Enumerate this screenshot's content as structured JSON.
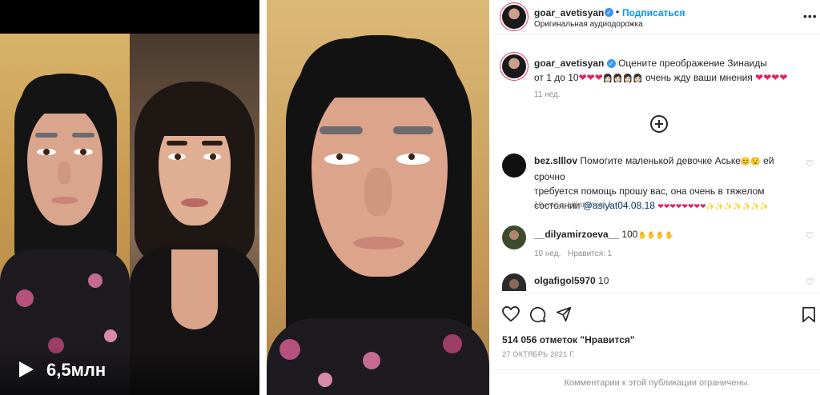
{
  "reel": {
    "views": "6,5млн",
    "play_icon": "play-icon"
  },
  "post": {
    "author": "goar_avetisyan",
    "follow_label": "Подписаться",
    "separator": "•",
    "audio": "Оригинальная аудиодорожка",
    "verified_icon": "verified-badge-icon",
    "more_icon": "more-options-icon"
  },
  "caption": {
    "username": "goar_avetisyan",
    "text_1": "Оцените преображение Зинаиды",
    "text_2": "от 1 до 10",
    "emoji_hearts_1": "❤❤❤",
    "emoji_faces": "👩🏻👩🏻👩🏻👩🏻",
    "text_3": "очень жду ваши мнения",
    "emoji_hearts_2": "❤❤❤❤",
    "time": "11 нед."
  },
  "load_more_icon": "add-circle-icon",
  "comments": [
    {
      "username": "bez.slllov",
      "text_1": "Помогите маленькой девочке Аське",
      "emoji_1": "😊😟",
      "text_2": "ей срочно",
      "line_2": "требуется помощь прошу вас, она очень в тяжелом",
      "line_3_text": "состоянии",
      "mention": "@asiyat04.08.18",
      "emoji_hearts": "❤❤❤❤❤❤❤❤",
      "emoji_stars": "✨✨✨✨✨✨✨",
      "time": "10 нед.",
      "likes": "Нравится: 1"
    },
    {
      "username": "__dilyamirzoeva__",
      "text": "100",
      "emoji": "✋✋✋✋",
      "time": "10 нед.",
      "likes": "Нравится: 1"
    },
    {
      "username": "olgafigol5970",
      "text": "10"
    }
  ],
  "actions": {
    "like_icon": "heart-icon",
    "comment_icon": "comment-icon",
    "share_icon": "share-icon",
    "save_icon": "bookmark-icon"
  },
  "likes_text": "514 056 отметок \"Нравится\"",
  "date": "27 ОКТЯБРЬ 2021 Г.",
  "comments_limited": "Комментарии к этой публикации ограничены."
}
